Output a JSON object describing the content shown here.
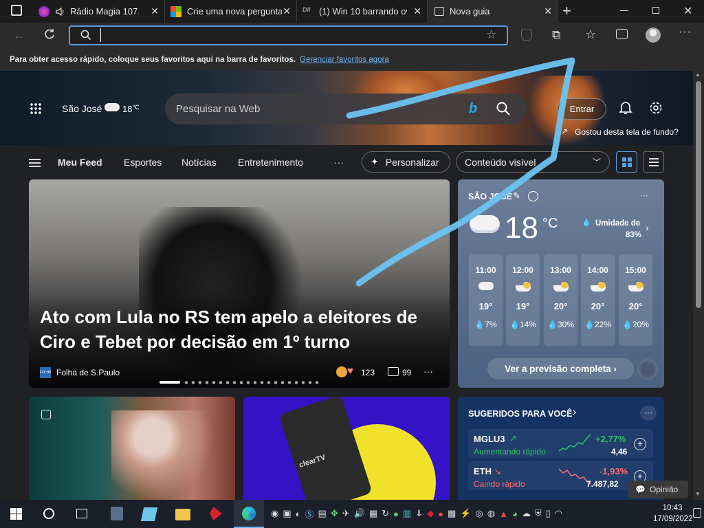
{
  "tabs": [
    {
      "title": "Rádio Magia 107.3",
      "active": false
    },
    {
      "title": "Crie uma nova pergunta",
      "active": false
    },
    {
      "title": "(1) Win 10 barrando ov",
      "active": false
    },
    {
      "title": "Nova guia",
      "active": true
    }
  ],
  "address": {
    "value": ""
  },
  "favbar": {
    "text": "Para obter acesso rápido, coloque seus favoritos aqui na barra de favoritos.",
    "link": "Gerenciar favoritos agora"
  },
  "header": {
    "location": "São José",
    "temp": "18",
    "unit": "℃",
    "search_placeholder": "Pesquisar na Web",
    "signin": "Entrar",
    "wallpaper_prompt": "Gostou desta tela de fundo?"
  },
  "nav": {
    "items": [
      "Meu Feed",
      "Esportes",
      "Notícias",
      "Entretenimento"
    ],
    "more": "···",
    "personalize": "Personalizar",
    "content_visible": "Conteúdo visível"
  },
  "main_story": {
    "headline": "Ato com Lula no RS tem apelo a eleitores de Ciro e Tebet por decisão em 1º turno",
    "source": "Folha de S.Paulo",
    "source_logo": "FOLHA",
    "reactions": "123",
    "comments": "99",
    "more": "···"
  },
  "weather": {
    "city": "SÃO JOSÉ",
    "temp": "18",
    "unit": "°C",
    "humidity_label": "Umidade de",
    "humidity_value": "83%",
    "more": "···",
    "hours": [
      {
        "time": "11:00",
        "temp": "19°",
        "rain": "7%"
      },
      {
        "time": "12:00",
        "temp": "19°",
        "rain": "14%"
      },
      {
        "time": "13:00",
        "temp": "20°",
        "rain": "30%"
      },
      {
        "time": "14:00",
        "temp": "20°",
        "rain": "22%"
      },
      {
        "time": "15:00",
        "temp": "20°",
        "rain": "20%"
      }
    ],
    "forecast_button": "Ver a previsão completa ›"
  },
  "stocks": {
    "title": "SUGERIDOS PARA VOCÊ",
    "more": "···",
    "items": [
      {
        "symbol": "MGLU3",
        "trend": "Aumentando rápido",
        "change": "+2,77%",
        "price": "4,46",
        "color": "#27c75d"
      },
      {
        "symbol": "ETH",
        "trend": "Caindo rápido",
        "change": "-1,93%",
        "price": "7.487,82",
        "color": "#ff6b6b"
      }
    ]
  },
  "opinion": "Opinião",
  "card3_logo": "clearTV",
  "taskbar": {
    "time": "10:43",
    "date": "17/09/2022"
  },
  "colors": {
    "accent": "#5d9de3",
    "link": "#6cb4f5",
    "positive": "#27c75d",
    "negative": "#ff6b6b",
    "annotation": "#6cc3f2"
  }
}
